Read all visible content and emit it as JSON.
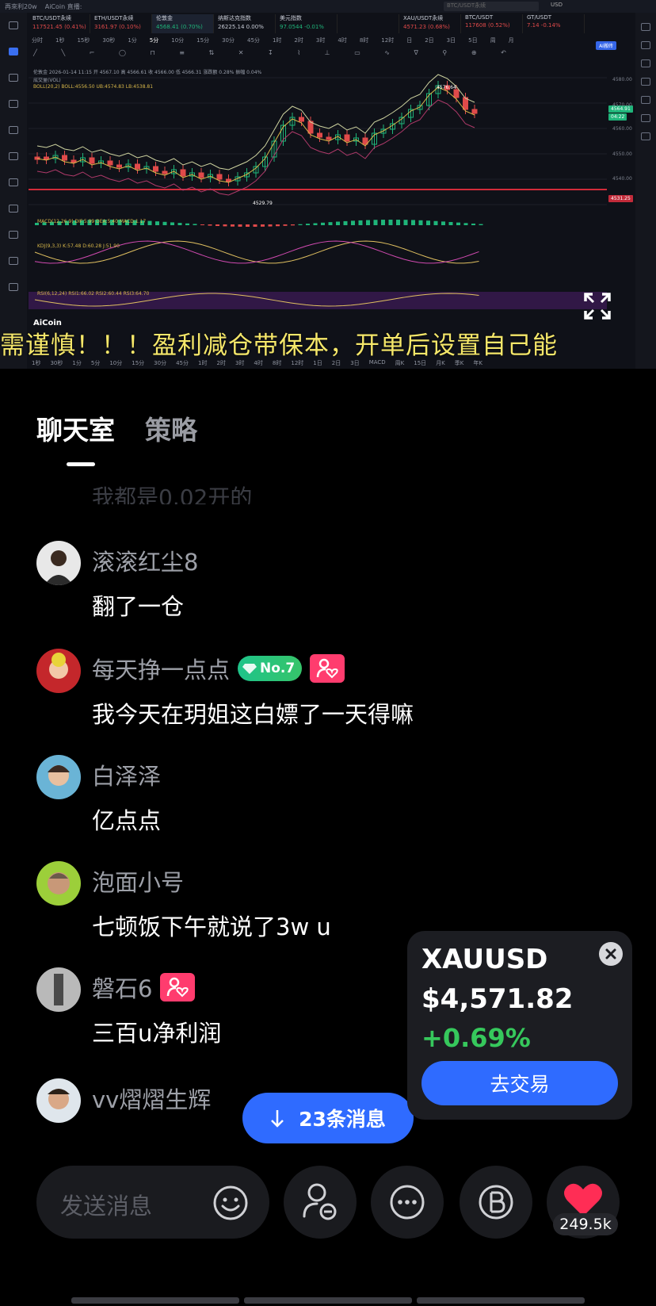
{
  "stream": {
    "title": "再來利20w",
    "channel": "AiCoin 直播:",
    "tickers": [
      {
        "name": "BTC/USDT永续",
        "price": "117521.45 (0.41%)",
        "dir": "down"
      },
      {
        "name": "ETH/USDT永续",
        "price": "3161.97 (0.10%)",
        "dir": "down"
      },
      {
        "name": "伦敦金",
        "price": "4568.41 (0.70%)",
        "dir": "up"
      },
      {
        "name": "纳斯达克指数",
        "price": "26225.14 0.00%",
        "dir": "flat"
      },
      {
        "name": "美元指数",
        "price": "97.0544 -0.01%",
        "dir": "up"
      },
      {
        "name": "",
        "price": "",
        "dir": "flat"
      },
      {
        "name": "XAU/USDT永续",
        "price": "4571.23 (0.68%)",
        "dir": "down"
      },
      {
        "name": "BTC/USDT",
        "price": "117608 (0.52%)",
        "dir": "down"
      },
      {
        "name": "GT/USDT",
        "price": "7.14 -0.14%",
        "dir": "down"
      }
    ],
    "timeframes": [
      "分时",
      "1秒",
      "15秒",
      "30秒",
      "1分",
      "5分",
      "10分",
      "15分",
      "30分",
      "45分",
      "1时",
      "2时",
      "3时",
      "4时",
      "8时",
      "12时",
      "日",
      "2日",
      "3日",
      "5日",
      "周",
      "月"
    ],
    "selected_timeframe": "5分",
    "ai_label": "AI搬砖",
    "search_placeholder": "BTC/USDT永续",
    "currency": "USD",
    "info_line1": "伦敦金 2026-01-14 11:15 开 4567.10 高 4566.61 收 4566.00 低 4566.31 涨跌额 0.28% 振幅 0.04%",
    "info_line2": "成交量(VOL)",
    "info_line3": "BOLL(20,2) BOLL:4556.50 UB:4574.83 LB:4538.81",
    "high_label": "4576.64",
    "low_label": "4529.79",
    "price_axis": [
      "4580.00",
      "4570.00",
      "4560.00",
      "4550.00",
      "4540.00"
    ],
    "last_price": "4564.91",
    "countdown": "04:22",
    "line_price": "4531.25",
    "macd_label": "MACD(12,26,9) DIF:5.99 DEA:5.40 MACD:1.17",
    "kdj_label": "KDJ(9,3,3) K:57.48 D:60.28 J:51.90",
    "rsi_label": "RSI(6,12,24) RSI1:66.02 RSI2:60.44 RSI3:64.70",
    "aicoin": "AiCoin",
    "marquee": "需谨慎！！！盈利减仓带保本，开单后设置自己能",
    "bottom_timeframes": [
      "1秒",
      "30秒",
      "1分",
      "5分",
      "10分",
      "15分",
      "30分",
      "45分",
      "1时",
      "2时",
      "3时",
      "4时",
      "8时",
      "12时",
      "1日",
      "2日",
      "3日",
      "MACD",
      "周K",
      "15日",
      "月K",
      "季K",
      "年K"
    ]
  },
  "tabs": [
    "聊天室",
    "策略"
  ],
  "partial_message": "我都是0.02开的",
  "messages": [
    {
      "user": "滚滚红尘8",
      "text": "翻了一仓",
      "avatar_color": "#e8e8e8"
    },
    {
      "user": "每天挣一点点",
      "text": "我今天在玥姐这白嫖了一天得嘛",
      "badge": "No.7",
      "fan": true,
      "avatar_color": "#c4272b"
    },
    {
      "user": "白泽泽",
      "text": "亿点点",
      "avatar_color": "#6ab4d6"
    },
    {
      "user": "泡面小号",
      "text": "七顿饭下午就说了3w  u",
      "avatar_color": "#9ccf3a"
    },
    {
      "user": "磐石6",
      "text": "三百u净利润",
      "fan": true,
      "avatar_color": "#b9b9b9"
    },
    {
      "user": "vv熠熠生辉",
      "text": "",
      "avatar_color": "#dfe6ec"
    }
  ],
  "new_messages": "23条消息",
  "quote": {
    "symbol": "XAUUSD",
    "price": "$4,571.82",
    "change": "+0.69%",
    "trade": "去交易"
  },
  "input_placeholder": "发送消息",
  "like_count": "249.5k",
  "colors": {
    "accent": "#2f6bff",
    "up": "#36c85c",
    "marquee": "#f5e76a",
    "heart": "#ff2d55"
  }
}
